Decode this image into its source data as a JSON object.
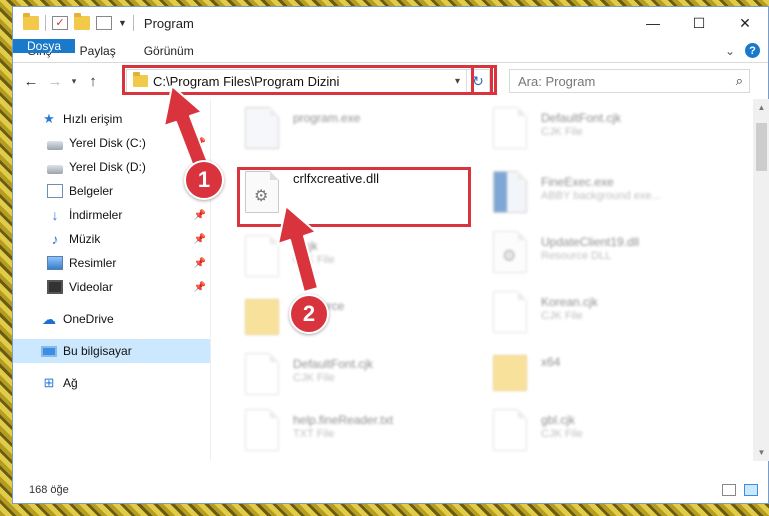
{
  "window": {
    "title": "Program",
    "controls": {
      "minimize": "—",
      "maximize": "☐",
      "close": "✕"
    }
  },
  "ribbon": {
    "tabs": [
      "Dosya",
      "Giriş",
      "Paylaş",
      "Görünüm"
    ],
    "expand_icon": "chevron-down-icon",
    "help_label": "?"
  },
  "nav": {
    "address": "C:\\Program Files\\Program Dizini",
    "search_placeholder": "Ara: Program"
  },
  "sidebar": {
    "items": [
      {
        "label": "Hızlı erişim",
        "icon": "star-icon"
      },
      {
        "label": "Yerel Disk (C:)",
        "icon": "drive-icon",
        "pinned": true
      },
      {
        "label": "Yerel Disk (D:)",
        "icon": "drive-icon",
        "pinned": true
      },
      {
        "label": "Belgeler",
        "icon": "documents-icon",
        "pinned": true
      },
      {
        "label": "İndirmeler",
        "icon": "download-icon",
        "pinned": true
      },
      {
        "label": "Müzik",
        "icon": "music-icon",
        "pinned": true
      },
      {
        "label": "Resimler",
        "icon": "pictures-icon",
        "pinned": true
      },
      {
        "label": "Videolar",
        "icon": "videos-icon",
        "pinned": true
      },
      {
        "label": "OneDrive",
        "icon": "cloud-icon"
      },
      {
        "label": "Bu bilgisayar",
        "icon": "computer-icon",
        "selected": true
      },
      {
        "label": "Ağ",
        "icon": "network-icon"
      }
    ]
  },
  "files": {
    "highlighted": {
      "name": "crlfxcreative.dll"
    },
    "left_column": [
      {
        "name": "program.exe",
        "type": ""
      },
      {
        "name": "...cjk",
        "type": "CJK File"
      },
      {
        "name": "Resource",
        "type": ""
      },
      {
        "name": "DefaultFont.cjk",
        "type": "CJK File"
      },
      {
        "name": "help.fineReader.txt",
        "type": "TXT File"
      }
    ],
    "right_column": [
      {
        "name": "DefaultFont.cjk",
        "type": "CJK File"
      },
      {
        "name": "FineExec.exe",
        "type": "ABBY background exe..."
      },
      {
        "name": "UpdateClient19.dll",
        "type": "Resource DLL"
      },
      {
        "name": "Korean.cjk",
        "type": "CJK File"
      },
      {
        "name": "x64",
        "type": ""
      },
      {
        "name": "gbl.cjk",
        "type": "CJK File"
      }
    ]
  },
  "status": {
    "count": "168 öğe"
  },
  "annotations": {
    "step1": "1",
    "step2": "2",
    "color": "#d9343d"
  }
}
